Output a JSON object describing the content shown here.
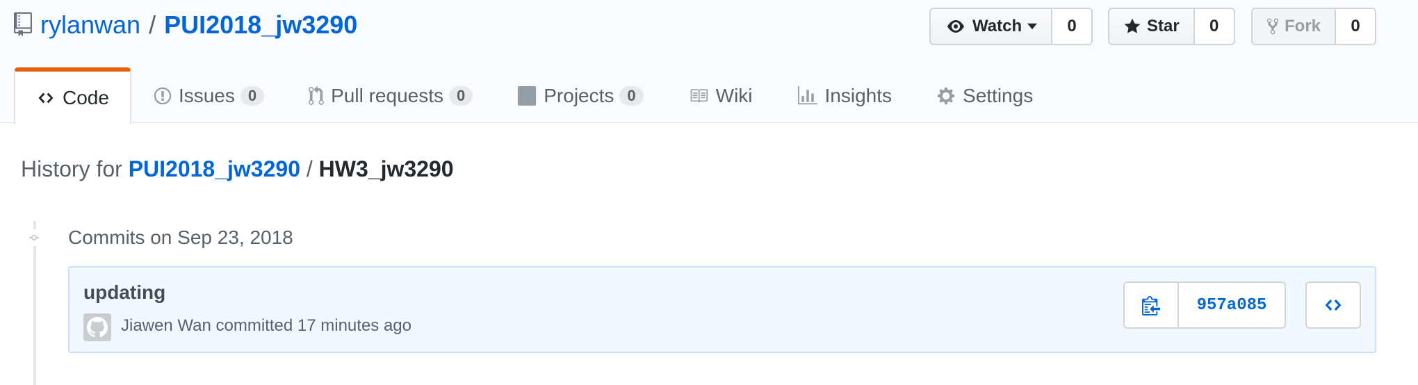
{
  "repo": {
    "owner": "rylanwan",
    "separator": "/",
    "name": "PUI2018_jw3290"
  },
  "actions": {
    "watch_label": "Watch",
    "watch_count": "0",
    "star_label": "Star",
    "star_count": "0",
    "fork_label": "Fork",
    "fork_count": "0"
  },
  "nav": {
    "code": "Code",
    "issues": "Issues",
    "issues_count": "0",
    "pulls": "Pull requests",
    "pulls_count": "0",
    "projects": "Projects",
    "projects_count": "0",
    "wiki": "Wiki",
    "insights": "Insights",
    "settings": "Settings"
  },
  "history": {
    "prefix": "History for",
    "repo_link": "PUI2018_jw3290",
    "separator": "/",
    "path": "HW3_jw3290"
  },
  "commits_group": {
    "date_label": "Commits on Sep 23, 2018",
    "commits": [
      {
        "message": "updating",
        "author": "Jiawen Wan",
        "action": "committed",
        "time": "17 minutes ago",
        "sha": "957a085"
      }
    ]
  },
  "colors": {
    "link": "#0366d6",
    "selected_tab_accent": "#e36209",
    "commit_bg": "#f1f8ff",
    "commit_border": "#c8e1ff"
  },
  "icons": [
    "repo-icon",
    "eye-icon",
    "star-icon",
    "fork-icon",
    "code-icon",
    "issue-icon",
    "pull-request-icon",
    "project-icon",
    "book-icon",
    "graph-icon",
    "gear-icon",
    "git-commit-icon",
    "clippy-icon",
    "browse-code-icon"
  ]
}
